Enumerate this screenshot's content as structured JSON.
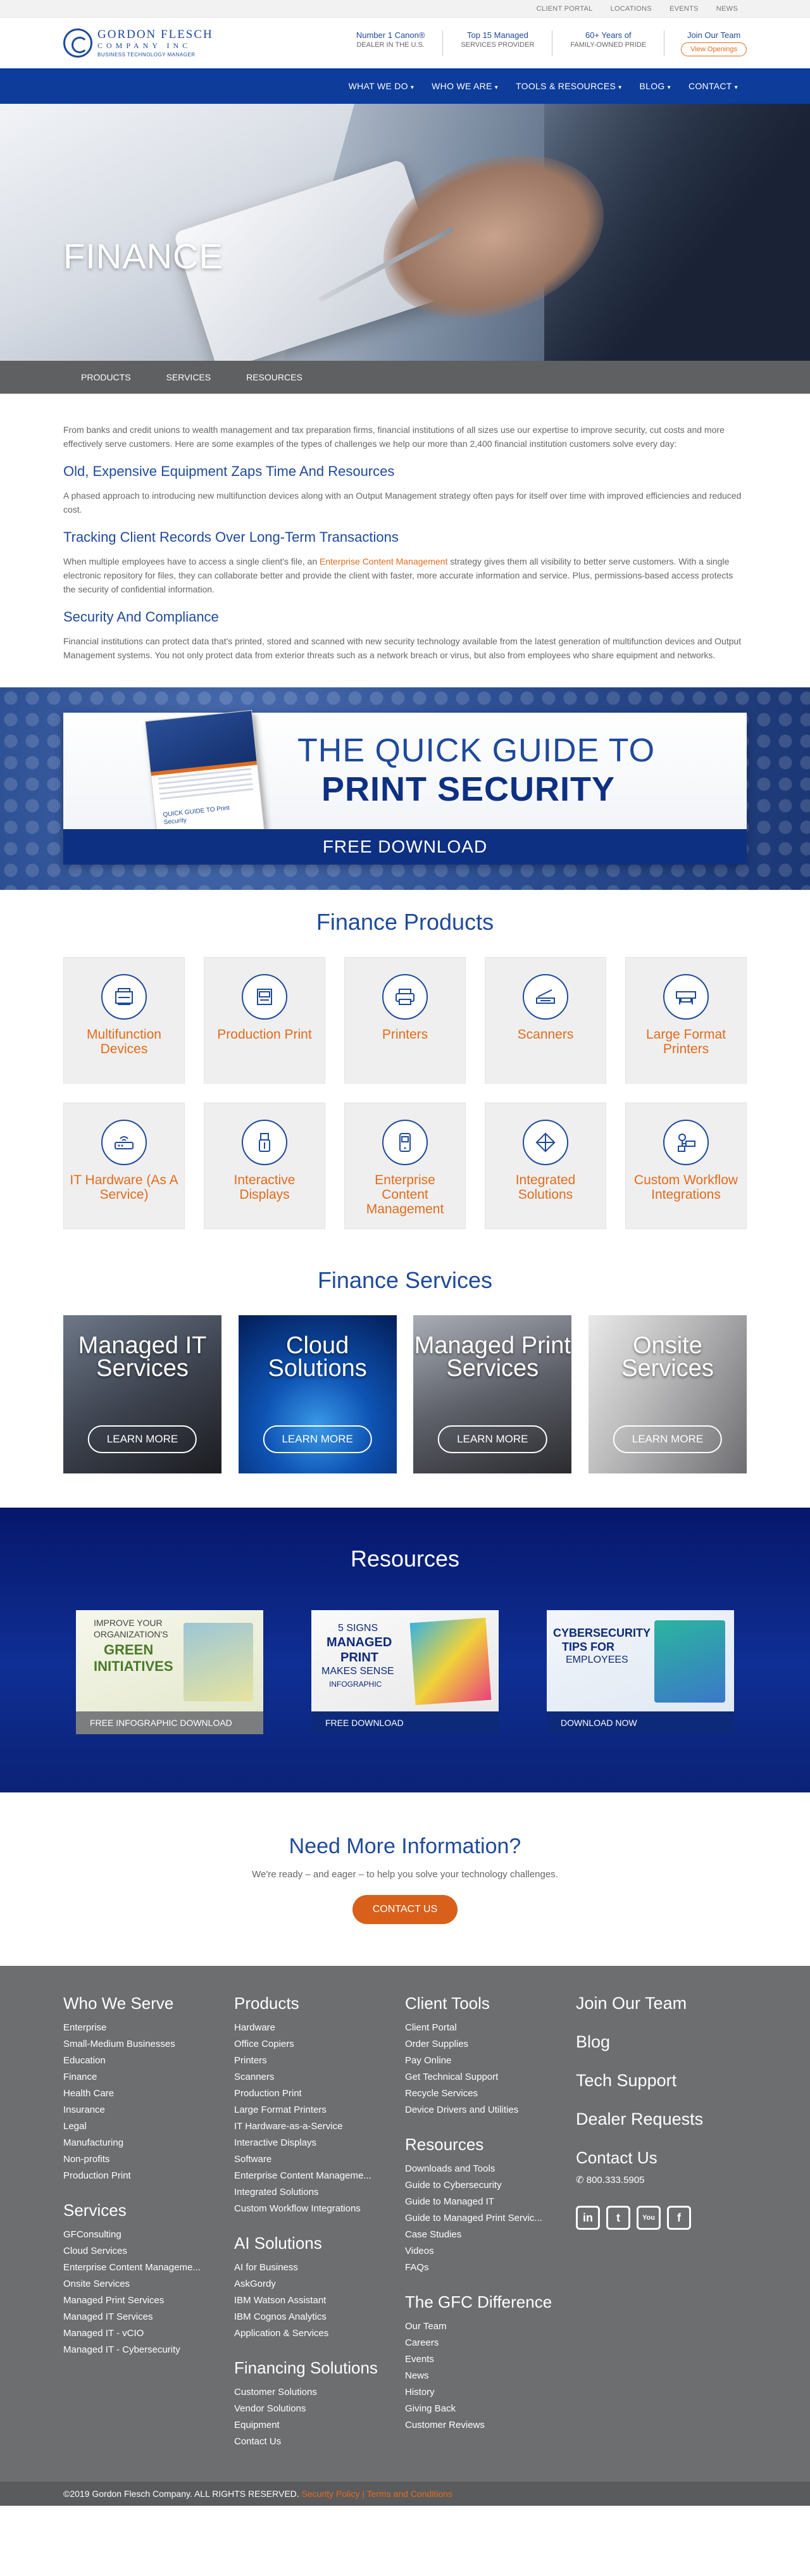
{
  "utility": [
    "CLIENT PORTAL",
    "LOCATIONS",
    "EVENTS",
    "NEWS"
  ],
  "logo": {
    "line1": "GORDON FLESCH",
    "line2": "COMPANY INC",
    "line3": "BUSINESS TECHNOLOGY MANAGER"
  },
  "claims": [
    {
      "top": "Number 1 Canon®",
      "bottom": "DEALER IN THE U.S."
    },
    {
      "top": "Top 15 Managed",
      "bottom": "SERVICES PROVIDER"
    },
    {
      "top": "60+ Years of",
      "bottom": "FAMILY-OWNED PRIDE"
    }
  ],
  "join": {
    "top": "Join Our Team",
    "button": "View Openings"
  },
  "nav": [
    "WHAT WE DO",
    "WHO WE ARE",
    "TOOLS & RESOURCES",
    "BLOG",
    "CONTACT"
  ],
  "hero": {
    "title": "FINANCE"
  },
  "subnav": [
    "PRODUCTS",
    "SERVICES",
    "RESOURCES"
  ],
  "content": {
    "intro": "From banks and credit unions to wealth management and tax preparation firms, financial institutions of all sizes use our expertise to improve security, cut costs and more effectively serve customers. Here are some examples of the types of challenges we help our more than 2,400 financial institution customers solve every day:",
    "h1": "Old, Expensive Equipment Zaps Time And Resources",
    "p1": "A phased approach to introducing new multifunction devices along with an Output Management strategy often pays for itself over time with improved efficiencies and reduced cost.",
    "h2": "Tracking Client Records Over Long-Term Transactions",
    "p2a": "When multiple employees have to access a single client's file, an ",
    "p2link": "Enterprise Content Management",
    "p2b": " strategy gives them all visibility to better serve customers. With a single electronic repository for files, they can collaborate better and provide the client with faster, more accurate information and service. Plus, permissions-based access protects the security of confidential information.",
    "h3": "Security And Compliance",
    "p3": "Financial institutions can protect data that's printed, stored and scanned with new security technology available from the latest generation of multifunction devices and Output Management systems. You not only protect data from exterior threats such as a network breach or virus, but also from employees who share equipment and networks."
  },
  "banner": {
    "line1": "THE QUICK GUIDE TO",
    "line2": "PRINT SECURITY",
    "cta": "FREE DOWNLOAD",
    "book_title": "QUICK GUIDE TO Print Security"
  },
  "products": {
    "title": "Finance Products",
    "items": [
      {
        "label": "Multifunction Devices",
        "icon": "mfp-icon"
      },
      {
        "label": "Production Print",
        "icon": "production-print-icon"
      },
      {
        "label": "Printers",
        "icon": "printer-icon"
      },
      {
        "label": "Scanners",
        "icon": "scanner-icon"
      },
      {
        "label": "Large Format Printers",
        "icon": "large-format-icon"
      },
      {
        "label": "IT Hardware (As A Service)",
        "icon": "router-icon"
      },
      {
        "label": "Interactive Displays",
        "icon": "usb-icon"
      },
      {
        "label": "Enterprise Content Management",
        "icon": "phone-icon"
      },
      {
        "label": "Integrated Solutions",
        "icon": "puzzle-icon"
      },
      {
        "label": "Custom Workflow Integrations",
        "icon": "workflow-icon"
      }
    ]
  },
  "services": {
    "title": "Finance Services",
    "items": [
      {
        "title": "Managed IT Services",
        "button": "LEARN MORE"
      },
      {
        "title": "Cloud Solutions",
        "button": "LEARN MORE"
      },
      {
        "title": "Managed Print Services",
        "button": "LEARN MORE"
      },
      {
        "title": "Onsite Services",
        "button": "LEARN MORE"
      }
    ]
  },
  "resources": {
    "title": "Resources",
    "items": [
      {
        "image_text": [
          "IMPROVE YOUR",
          "ORGANIZATION'S",
          "GREEN",
          "INITIATIVES"
        ],
        "button": "FREE INFOGRAPHIC DOWNLOAD"
      },
      {
        "image_text": [
          "5 SIGNS",
          "MANAGED",
          "PRINT",
          "MAKES SENSE",
          "INFOGRAPHIC"
        ],
        "button": "FREE DOWNLOAD"
      },
      {
        "image_text": [
          "CYBERSECURITY",
          "TIPS FOR",
          "EMPLOYEES"
        ],
        "button": "DOWNLOAD NOW"
      }
    ]
  },
  "more": {
    "title": "Need More Information?",
    "text": "We're ready – and eager – to help you solve your technology challenges.",
    "cta": "CONTACT US"
  },
  "footer": {
    "who_we_serve": {
      "title": "Who We Serve",
      "items": [
        "Enterprise",
        "Small-Medium Businesses",
        "Education",
        "Finance",
        "Health Care",
        "Insurance",
        "Legal",
        "Manufacturing",
        "Non-profits",
        "Production Print"
      ]
    },
    "services": {
      "title": "Services",
      "items": [
        "GFConsulting",
        "Cloud Services",
        "Enterprise Content Manageme...",
        "Onsite Services",
        "Managed Print Services",
        "Managed IT Services",
        "Managed IT - vCIO",
        "Managed IT - Cybersecurity"
      ]
    },
    "products": {
      "title": "Products",
      "items": [
        "Hardware",
        "Office Copiers",
        "Printers",
        "Scanners",
        "Production Print",
        "Large Format Printers",
        "IT Hardware-as-a-Service",
        "Interactive Displays",
        "Software",
        "Enterprise Content Manageme...",
        "Integrated Solutions",
        "Custom Workflow Integrations"
      ]
    },
    "ai": {
      "title": "AI Solutions",
      "items": [
        "AI for Business",
        "AskGordy",
        "IBM Watson Assistant",
        "IBM Cognos Analytics",
        "Application & Services"
      ]
    },
    "financing": {
      "title": "Financing Solutions",
      "items": [
        "Customer Solutions",
        "Vendor Solutions",
        "Equipment",
        "Contact Us"
      ]
    },
    "client_tools": {
      "title": "Client Tools",
      "items": [
        "Client Portal",
        "Order Supplies",
        "Pay Online",
        "Get Technical Support",
        "Recycle Services",
        "Device Drivers and Utilities"
      ]
    },
    "resources": {
      "title": "Resources",
      "items": [
        "Downloads and Tools",
        "Guide to Cybersecurity",
        "Guide to Managed IT",
        "Guide to Managed Print Servic...",
        "Case Studies",
        "Videos",
        "FAQs"
      ]
    },
    "difference": {
      "title": "The GFC Difference",
      "items": [
        "Our Team",
        "Careers",
        "Events",
        "News",
        "History",
        "Giving Back",
        "Customer Reviews"
      ]
    },
    "links": [
      "Join Our Team",
      "Blog",
      "Tech Support",
      "Dealer Requests"
    ],
    "contact": {
      "title": "Contact Us",
      "phone": "800.333.5905"
    },
    "socials": [
      "in",
      "t",
      "You",
      "f"
    ]
  },
  "copyright": {
    "text": "©2019 Gordon Flesch Company. ALL RIGHTS RESERVED.",
    "privacy": "Security Policy",
    "sep": "|",
    "terms": "Terms and Conditions"
  }
}
